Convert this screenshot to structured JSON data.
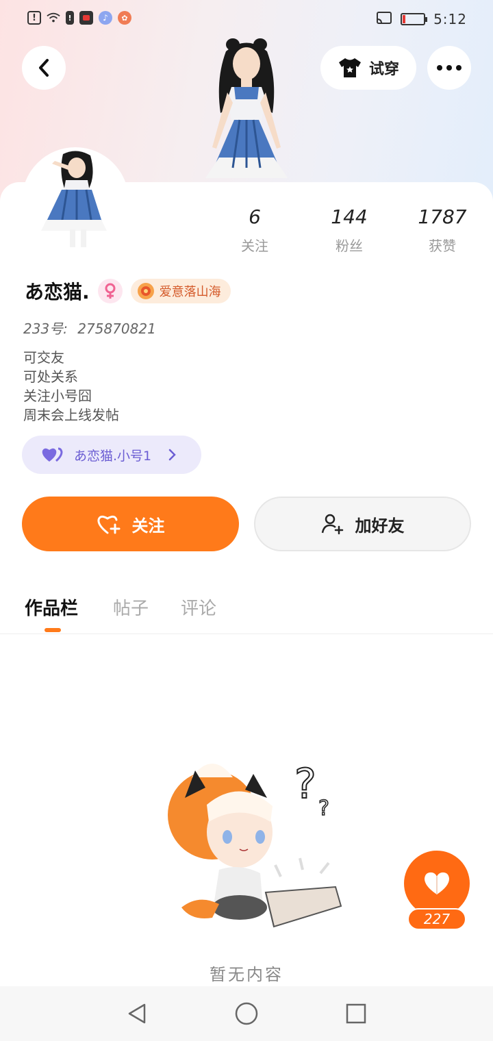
{
  "status_bar": {
    "time": "5:12"
  },
  "header": {
    "try_on_label": "试穿"
  },
  "profile": {
    "name": "あ恋猫.",
    "tag": "爱意落山海",
    "uid_label": "233号:",
    "uid_value": "275870821",
    "bio_lines": [
      "可交友",
      "可处关系",
      "关注小号囧",
      "周末会上线发帖"
    ],
    "sub_account": "あ恋猫.小号1"
  },
  "stats": [
    {
      "value": "6",
      "label": "关注"
    },
    {
      "value": "144",
      "label": "粉丝"
    },
    {
      "value": "1787",
      "label": "获赞"
    }
  ],
  "actions": {
    "follow_label": "关注",
    "add_friend_label": "加好友"
  },
  "tabs": [
    {
      "label": "作品栏",
      "active": true
    },
    {
      "label": "帖子",
      "active": false
    },
    {
      "label": "评论",
      "active": false
    }
  ],
  "empty_state": {
    "text": "暂无内容"
  },
  "like_fab": {
    "count": "227"
  },
  "colors": {
    "accent": "#ff7a1a",
    "sub_account_bg": "#eceafb",
    "sub_account_text": "#6b5dd3"
  }
}
